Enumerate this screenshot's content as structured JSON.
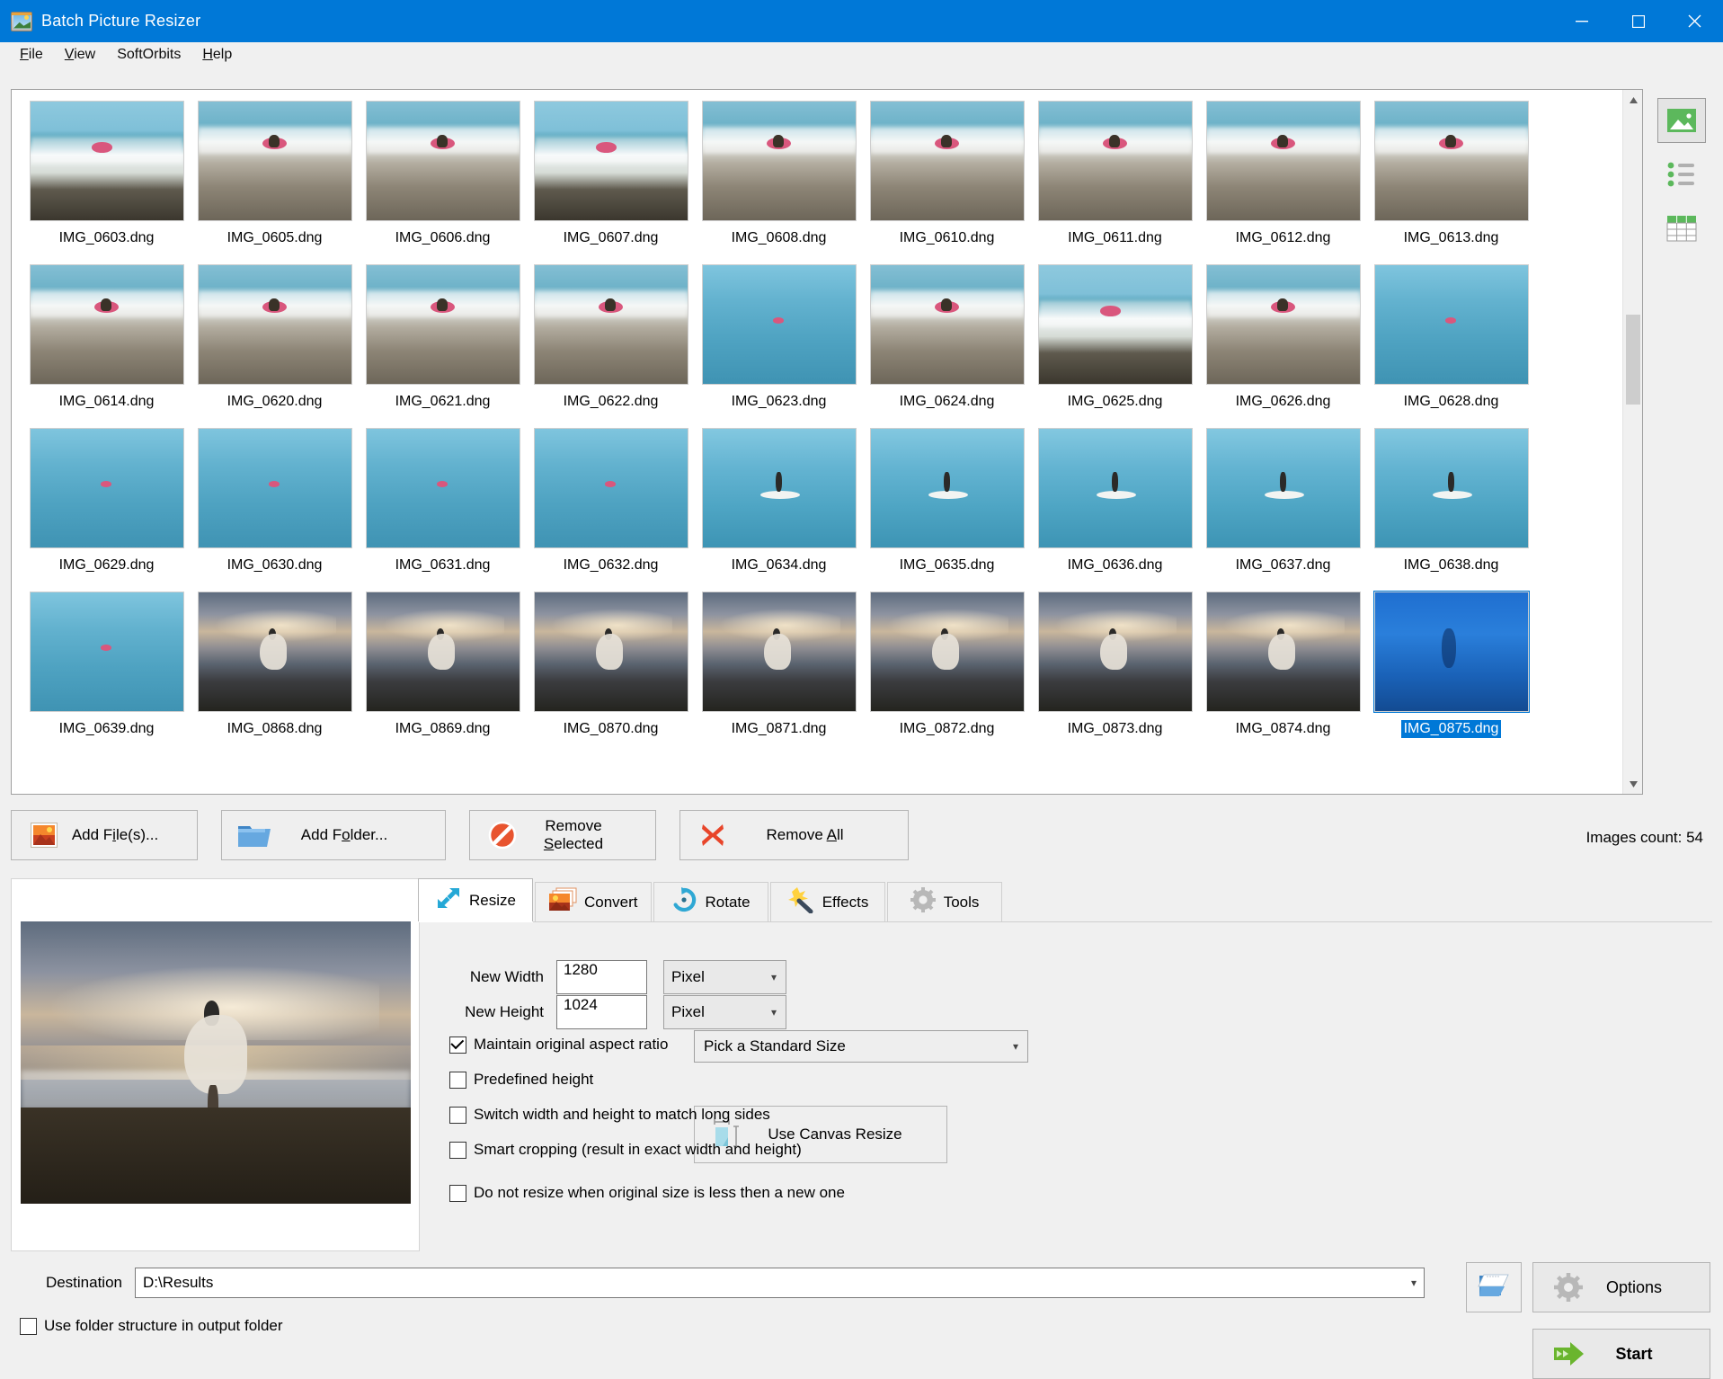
{
  "window": {
    "title": "Batch Picture Resizer",
    "app_icon": "picture-resizer-icon",
    "minimize_label": "Minimize",
    "maximize_label": "Maximize",
    "close_label": "Close"
  },
  "menubar": {
    "items": [
      {
        "label": "File",
        "accel": "F"
      },
      {
        "label": "View",
        "accel": "V"
      },
      {
        "label": "SoftOrbits",
        "accel": ""
      },
      {
        "label": "Help",
        "accel": "H"
      }
    ]
  },
  "view_modes": [
    {
      "name": "thumbnails-view",
      "icon": "picture-icon",
      "active": true
    },
    {
      "name": "list-view",
      "icon": "list-icon",
      "active": false
    },
    {
      "name": "details-view",
      "icon": "table-icon",
      "active": false
    }
  ],
  "thumbnails": {
    "rows": [
      [
        {
          "name": "IMG_0603.dng",
          "kind": "k-wave",
          "selected": false
        },
        {
          "name": "IMG_0605.dng",
          "kind": "k-pebble",
          "selected": false
        },
        {
          "name": "IMG_0606.dng",
          "kind": "k-pebble",
          "selected": false
        },
        {
          "name": "IMG_0607.dng",
          "kind": "k-wave",
          "selected": false
        },
        {
          "name": "IMG_0608.dng",
          "kind": "k-pebble",
          "selected": false
        },
        {
          "name": "IMG_0610.dng",
          "kind": "k-pebble",
          "selected": false
        },
        {
          "name": "IMG_0611.dng",
          "kind": "k-pebble",
          "selected": false
        },
        {
          "name": "IMG_0612.dng",
          "kind": "k-pebble",
          "selected": false
        },
        {
          "name": "IMG_0613.dng",
          "kind": "k-pebble",
          "selected": false
        }
      ],
      [
        {
          "name": "IMG_0614.dng",
          "kind": "k-pebble",
          "selected": false
        },
        {
          "name": "IMG_0620.dng",
          "kind": "k-pebble",
          "selected": false
        },
        {
          "name": "IMG_0621.dng",
          "kind": "k-pebble",
          "selected": false
        },
        {
          "name": "IMG_0622.dng",
          "kind": "k-pebble",
          "selected": false
        },
        {
          "name": "IMG_0623.dng",
          "kind": "k-open",
          "selected": false
        },
        {
          "name": "IMG_0624.dng",
          "kind": "k-pebble",
          "selected": false
        },
        {
          "name": "IMG_0625.dng",
          "kind": "k-wave",
          "selected": false
        },
        {
          "name": "IMG_0626.dng",
          "kind": "k-pebble",
          "selected": false
        },
        {
          "name": "IMG_0628.dng",
          "kind": "k-open",
          "selected": false
        }
      ],
      [
        {
          "name": "IMG_0629.dng",
          "kind": "k-open",
          "selected": false
        },
        {
          "name": "IMG_0630.dng",
          "kind": "k-open",
          "selected": false
        },
        {
          "name": "IMG_0631.dng",
          "kind": "k-open",
          "selected": false
        },
        {
          "name": "IMG_0632.dng",
          "kind": "k-open",
          "selected": false
        },
        {
          "name": "IMG_0634.dng",
          "kind": "k-sup",
          "selected": false
        },
        {
          "name": "IMG_0635.dng",
          "kind": "k-sup",
          "selected": false
        },
        {
          "name": "IMG_0636.dng",
          "kind": "k-sup",
          "selected": false
        },
        {
          "name": "IMG_0637.dng",
          "kind": "k-sup",
          "selected": false
        },
        {
          "name": "IMG_0638.dng",
          "kind": "k-sup",
          "selected": false
        }
      ],
      [
        {
          "name": "IMG_0639.dng",
          "kind": "k-open",
          "selected": false
        },
        {
          "name": "IMG_0868.dng",
          "kind": "k-sunset",
          "selected": false
        },
        {
          "name": "IMG_0869.dng",
          "kind": "k-sunset",
          "selected": false
        },
        {
          "name": "IMG_0870.dng",
          "kind": "k-sunset",
          "selected": false
        },
        {
          "name": "IMG_0871.dng",
          "kind": "k-sunset",
          "selected": false
        },
        {
          "name": "IMG_0872.dng",
          "kind": "k-sunset",
          "selected": false
        },
        {
          "name": "IMG_0873.dng",
          "kind": "k-sunset",
          "selected": false
        },
        {
          "name": "IMG_0874.dng",
          "kind": "k-sunset",
          "selected": false
        },
        {
          "name": "IMG_0875.dng",
          "kind": "k-pool",
          "selected": true
        }
      ]
    ]
  },
  "actions": {
    "add_files": "Add File(s)...",
    "add_folder": "Add Folder...",
    "remove_selected": "Remove Selected",
    "remove_all": "Remove All",
    "images_count_label": "Images count: 54"
  },
  "preview": {
    "name": "preview-image"
  },
  "tabs": [
    {
      "label": "Resize",
      "icon": "resize-arrows-icon",
      "active": true
    },
    {
      "label": "Convert",
      "icon": "convert-images-icon",
      "active": false
    },
    {
      "label": "Rotate",
      "icon": "rotate-circle-icon",
      "active": false
    },
    {
      "label": "Effects",
      "icon": "magic-wand-icon",
      "active": false
    },
    {
      "label": "Tools",
      "icon": "gear-icon",
      "active": false
    }
  ],
  "resize": {
    "new_width_label": "New Width",
    "new_width_value": "1280",
    "new_width_unit": "Pixel",
    "new_height_label": "New Height",
    "new_height_value": "1024",
    "new_height_unit": "Pixel",
    "standard_size_label": "Pick a Standard Size",
    "canvas_resize_label": "Use Canvas Resize",
    "checkboxes": [
      {
        "label": "Maintain original aspect ratio",
        "checked": true
      },
      {
        "label": "Predefined height",
        "checked": false
      },
      {
        "label": "Switch width and height to match long sides",
        "checked": false
      },
      {
        "label": "Smart cropping (result in exact width and height)",
        "checked": false
      },
      {
        "label": "Do not resize when original size is less then a new one",
        "checked": false
      }
    ]
  },
  "footer": {
    "destination_label": "Destination",
    "destination_value": "D:\\Results",
    "browse_icon": "open-folder-icon",
    "use_folder_structure_label": "Use folder structure in output folder",
    "use_folder_structure_checked": false,
    "options_label": "Options",
    "start_label": "Start"
  },
  "colors": {
    "accent": "#0078d7",
    "chrome": "#f0f0f0",
    "start_green": "#5faa2f",
    "remove_red": "#e8542f"
  }
}
